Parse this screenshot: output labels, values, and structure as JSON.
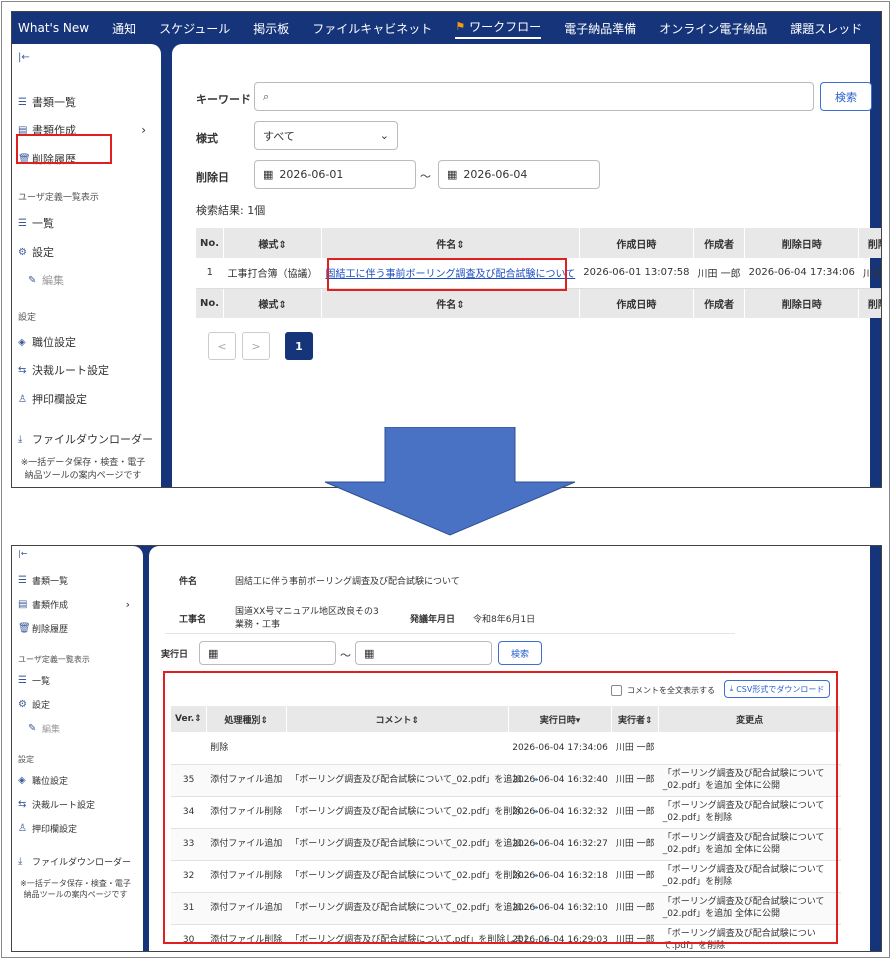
{
  "top_screen": {
    "nav": [
      "What's New",
      "通知",
      "スケジュール",
      "掲示板",
      "ファイルキャビネット",
      "ワークフロー",
      "電子納品準備",
      "オンライン電子納品",
      "課題スレッド"
    ],
    "sidebar": {
      "collapse": "|←",
      "items": [
        "書類一覧",
        "書類作成",
        "削除履歴"
      ],
      "group_user": "ユーザ定義一覧表示",
      "user_items": [
        "一覧",
        "設定",
        "編集"
      ],
      "group_settings": "設定",
      "settings_items": [
        "職位設定",
        "決裁ルート設定",
        "押印欄設定"
      ],
      "downloader": "ファイルダウンローダー",
      "note": "※一括データ保存・検査・電子納品ツールの案内ページです"
    },
    "search": {
      "keyword_label": "キーワード",
      "keyword_value": "",
      "search_button": "検索",
      "style_label": "様式",
      "style_value": "すべて",
      "deleted_label": "削除日",
      "date_from": "2026-06-01",
      "tilde": "～",
      "date_to": "2026-06-04",
      "result": "検索結果: 1個"
    },
    "table": {
      "headers": [
        "No.",
        "様式",
        "件名",
        "作成日時",
        "作成者",
        "削除日時",
        "削除者"
      ],
      "row": [
        "1",
        "工事打合簿（協議）",
        "固結工に伴う事前ボーリング調査及び配合試験について",
        "2026-06-01 13:07:58",
        "川田 一郎",
        "2026-06-04 17:34:06",
        "川田一郎"
      ]
    },
    "pager": {
      "prev": "<",
      "next": ">",
      "current": "1"
    }
  },
  "bottom_screen": {
    "sidebar": {
      "collapse": "|←",
      "items": [
        "書類一覧",
        "書類作成",
        "削除履歴"
      ],
      "group_user": "ユーザ定義一覧表示",
      "user_items": [
        "一覧",
        "設定",
        "編集"
      ],
      "group_settings": "設定",
      "settings_items": [
        "職位設定",
        "決裁ルート設定",
        "押印欄設定"
      ],
      "downloader": "ファイルダウンローダー",
      "note": "※一括データ保存・検査・電子納品ツールの案内ページです"
    },
    "info": {
      "subject_label": "件名",
      "subject_value": "固結工に伴う事前ボーリング調査及び配合試験について",
      "project_label": "工事名",
      "project_value": "国道XX号マニュアル地区改良その3業務・工事",
      "order_label": "発議年月日",
      "order_value": "令和8年6月1日"
    },
    "filter": {
      "label": "実行日",
      "tilde": "～",
      "search_button": "検索"
    },
    "options": {
      "checkbox_label": "コメントを全文表示する",
      "csv_button": "CSV形式でダウンロード"
    },
    "table": {
      "headers": [
        "Ver.",
        "処理種別",
        "コメント",
        "実行日時",
        "実行者",
        "変更点"
      ],
      "rows": [
        {
          "ver": "",
          "type": "削除",
          "comment": "",
          "time": "2026-06-04 17:34:06",
          "user": "川田 一郎",
          "change": ""
        },
        {
          "ver": "35",
          "type": "添付ファイル追加",
          "comment": "「ボーリング調査及び配合試験について_02.pdf」を追加...",
          "time": "2026-06-04 16:32:40",
          "user": "川田 一郎",
          "change": "「ボーリング調査及び配合試験について_02.pdf」を追加 全体に公開"
        },
        {
          "ver": "34",
          "type": "添付ファイル削除",
          "comment": "「ボーリング調査及び配合試験について_02.pdf」を削除...",
          "time": "2026-06-04 16:32:32",
          "user": "川田 一郎",
          "change": "「ボーリング調査及び配合試験について_02.pdf」を削除"
        },
        {
          "ver": "33",
          "type": "添付ファイル追加",
          "comment": "「ボーリング調査及び配合試験について_02.pdf」を追加...",
          "time": "2026-06-04 16:32:27",
          "user": "川田 一郎",
          "change": "「ボーリング調査及び配合試験について_02.pdf」を追加 全体に公開"
        },
        {
          "ver": "32",
          "type": "添付ファイル削除",
          "comment": "「ボーリング調査及び配合試験について_02.pdf」を削除...",
          "time": "2026-06-04 16:32:18",
          "user": "川田 一郎",
          "change": "「ボーリング調査及び配合試験について_02.pdf」を削除"
        },
        {
          "ver": "31",
          "type": "添付ファイル追加",
          "comment": "「ボーリング調査及び配合試験について_02.pdf」を追加...",
          "time": "2026-06-04 16:32:10",
          "user": "川田 一郎",
          "change": "「ボーリング調査及び配合試験について_02.pdf」を追加 全体に公開"
        },
        {
          "ver": "30",
          "type": "添付ファイル削除",
          "comment": "「ボーリング調査及び配合試験について.pdf」を削除しまし...",
          "time": "2026-06-04 16:29:03",
          "user": "川田 一郎",
          "change": "「ボーリング調査及び配合試験について.pdf」を削除"
        }
      ]
    }
  },
  "colors": {
    "navy": "#16347a",
    "highlight": "#e02020",
    "arrow": "#4a72c4"
  }
}
